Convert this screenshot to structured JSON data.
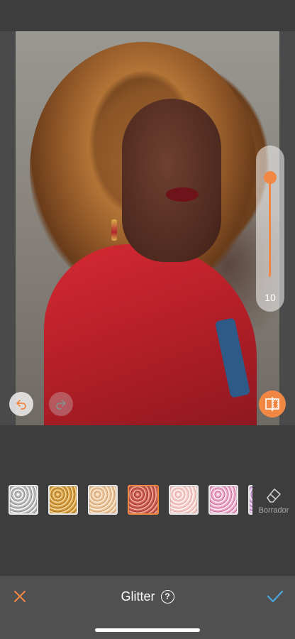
{
  "editor": {
    "slider": {
      "value_label": "10",
      "level": 0.1
    },
    "buttons": {
      "undo_icon": "undo-arrow",
      "redo_icon": "redo-arrow",
      "compare_icon": "compare-split"
    }
  },
  "swatches": [
    {
      "name": "silver",
      "selected": false
    },
    {
      "name": "gold",
      "selected": false
    },
    {
      "name": "champagne",
      "selected": false
    },
    {
      "name": "rose",
      "selected": true
    },
    {
      "name": "blush",
      "selected": false
    },
    {
      "name": "pink",
      "selected": false
    },
    {
      "name": "lilac",
      "selected": false
    }
  ],
  "eraser": {
    "label": "Borrador",
    "icon": "eraser-icon"
  },
  "bottom_bar": {
    "title": "Glitter",
    "help_symbol": "?",
    "cancel_icon": "close-icon",
    "confirm_icon": "check-icon"
  },
  "colors": {
    "accent": "#f08844",
    "confirm": "#4aa9e0",
    "background": "#3d3d3d",
    "bottom_bar": "#505050"
  }
}
